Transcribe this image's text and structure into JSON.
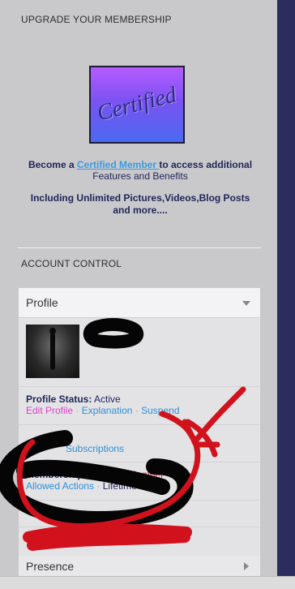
{
  "upgrade": {
    "title": "UPGRADE YOUR MEMBERSHIP",
    "badge_text": "Certified",
    "line1_pre": "Become a ",
    "line1_link": "Certified Member ",
    "line1_post": " to access additional",
    "line2": "Features and Benefits",
    "line3": "Including Unlimited Pictures,Videos,Blog Posts",
    "line4": "and more...."
  },
  "account": {
    "title": "ACCOUNT CONTROL",
    "panel_label": "Profile",
    "profile_status_label": "Profile Status:",
    "profile_status_value": "Active",
    "edit_profile": "Edit Profile",
    "explanation": "Explanation",
    "suspend": "Suspend",
    "subscriptions": "Subscriptions",
    "membership_label": "Membership:",
    "membership_value": "Certified Member",
    "allowed_actions": "Allowed Actions",
    "lifetime": "Lifetime",
    "separator": "·",
    "presence_label": "Presence"
  },
  "colors": {
    "link": "#2f8fd6",
    "pink_link": "#e040c8",
    "membership_red": "#e0283a",
    "heading_navy": "#1e2457",
    "scribble_red": "#d1121d"
  },
  "icons": {
    "panel_toggle": "chevron-down-icon",
    "presence_toggle": "chevron-right-icon"
  }
}
